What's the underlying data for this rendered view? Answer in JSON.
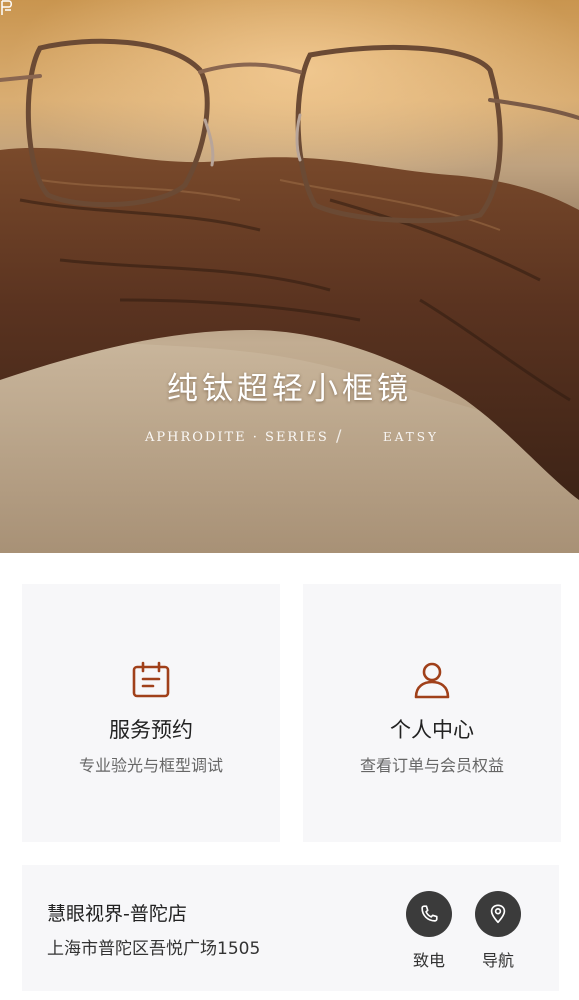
{
  "hero": {
    "title": "纯钛超轻小框镜",
    "series": "APHRODITE · SERIES",
    "brand": "EATSY"
  },
  "cards": [
    {
      "title": "服务预约",
      "subtitle": "专业验光与框型调试",
      "icon": "calendar-icon"
    },
    {
      "title": "个人中心",
      "subtitle": "查看订单与会员权益",
      "icon": "user-icon"
    }
  ],
  "store": {
    "name": "慧眼视界-普陀店",
    "address": "上海市普陀区吾悦广场1505",
    "actions": [
      {
        "label": "致电",
        "icon": "phone-icon"
      },
      {
        "label": "导航",
        "icon": "location-pin-icon"
      }
    ]
  },
  "colors": {
    "accent": "#a0401a",
    "card_bg": "#f7f7f9",
    "action_bg": "#3b3b3b"
  }
}
